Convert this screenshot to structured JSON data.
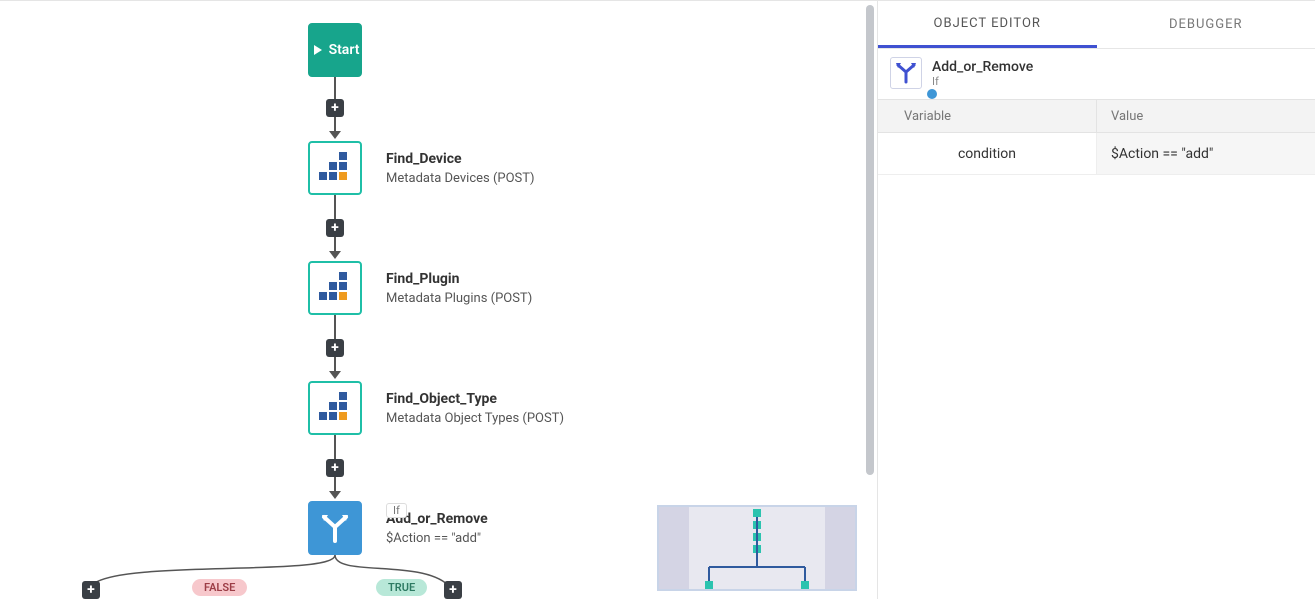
{
  "canvas": {
    "start": {
      "label": "Start"
    },
    "nodes": [
      {
        "title": "Find_Device",
        "subtitle": "Metadata Devices (POST)"
      },
      {
        "title": "Find_Plugin",
        "subtitle": "Metadata Plugins (POST)"
      },
      {
        "title": "Find_Object_Type",
        "subtitle": "Metadata Object Types (POST)"
      }
    ],
    "branch": {
      "if_label": "If",
      "title": "Add_or_Remove",
      "condition": "$Action == \"add\"",
      "false_label": "FALSE",
      "true_label": "TRUE"
    }
  },
  "editor": {
    "tabs": {
      "object": "OBJECT EDITOR",
      "debugger": "DEBUGGER"
    },
    "header": {
      "title": "Add_or_Remove",
      "type": "If"
    },
    "columns": {
      "variable": "Variable",
      "value": "Value"
    },
    "rows": [
      {
        "variable": "condition",
        "value": "$Action == \"add\""
      }
    ]
  }
}
